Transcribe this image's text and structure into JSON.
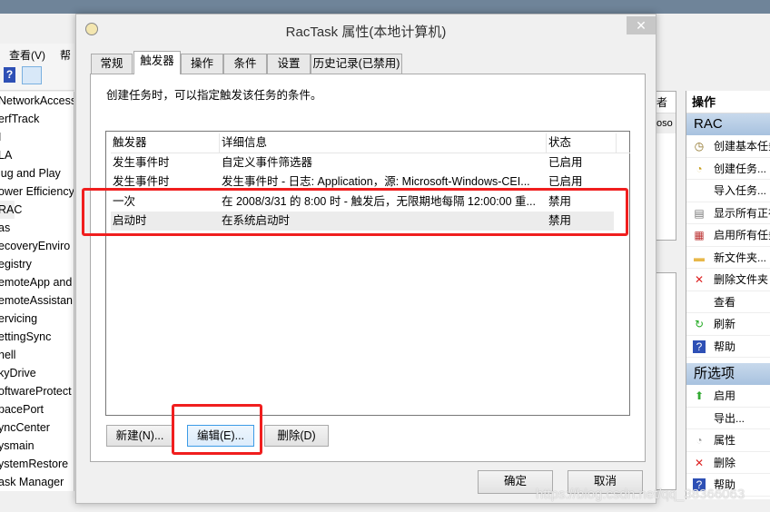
{
  "main_window": {
    "menu": [
      "查看(V)",
      "帮助"
    ],
    "tree_items": [
      "NetworkAccess",
      "erfTrack",
      "I",
      "LA",
      "lug and Play",
      "ower Efficiency",
      "RAC",
      "as",
      "ecoveryEnviro",
      "egistry",
      "emoteApp and",
      "emoteAssistan",
      "ervicing",
      "ettingSync",
      "hell",
      "kyDrive",
      "oftwareProtect",
      "pacePort",
      "yncCenter",
      "ysmain",
      "ystemRestore",
      "ask Manager"
    ],
    "selected_tree_item": "RAC",
    "mid_header": "者",
    "mid_cell": "oso"
  },
  "actions": {
    "header": "操作",
    "section1": "RAC",
    "section1_items": [
      {
        "label": "创建基本任务...",
        "icon": "create-basic-task-icon"
      },
      {
        "label": "创建任务...",
        "icon": "create-task-icon"
      },
      {
        "label": "导入任务...",
        "icon": ""
      },
      {
        "label": "显示所有正在运行的任务",
        "icon": "running-tasks-icon"
      },
      {
        "label": "启用所有任务历史记录",
        "icon": "enable-history-icon"
      },
      {
        "label": "新文件夹...",
        "icon": "new-folder-icon"
      },
      {
        "label": "删除文件夹",
        "icon": "delete-icon"
      },
      {
        "label": "查看",
        "icon": ""
      },
      {
        "label": "刷新",
        "icon": "refresh-icon"
      },
      {
        "label": "帮助",
        "icon": "help-icon"
      }
    ],
    "section2": "所选项",
    "section2_items": [
      {
        "label": "启用",
        "icon": "enable-arrow-icon"
      },
      {
        "label": "导出...",
        "icon": ""
      },
      {
        "label": "属性",
        "icon": "properties-clock-icon"
      },
      {
        "label": "删除",
        "icon": "delete-icon"
      },
      {
        "label": "帮助",
        "icon": "help-icon"
      }
    ]
  },
  "dialog": {
    "title": "RacTask 属性(本地计算机)",
    "tabs": [
      "常规",
      "触发器",
      "操作",
      "条件",
      "设置",
      "历史记录(已禁用)"
    ],
    "active_tab": "触发器",
    "description": "创建任务时，可以指定触发该任务的条件。",
    "columns": [
      "触发器",
      "详细信息",
      "状态"
    ],
    "rows": [
      [
        "发生事件时",
        "自定义事件筛选器",
        "已启用"
      ],
      [
        "发生事件时",
        "发生事件时 - 日志: Application，源: Microsoft-Windows-CEI...",
        "已启用"
      ],
      [
        "一次",
        "在 2008/3/31 的 8:00 时 - 触发后，无限期地每隔 12:00:00 重...",
        "禁用"
      ],
      [
        "启动时",
        "在系统启动时",
        "禁用"
      ]
    ],
    "buttons": {
      "new": "新建(N)...",
      "edit": "编辑(E)...",
      "delete": "删除(D)",
      "ok": "确定",
      "cancel": "取消"
    }
  },
  "watermark": "https://blog.csdn.net/qq_38366063",
  "colors": {
    "highlight": "#f01e1e",
    "section_header": "#b8cde6"
  }
}
